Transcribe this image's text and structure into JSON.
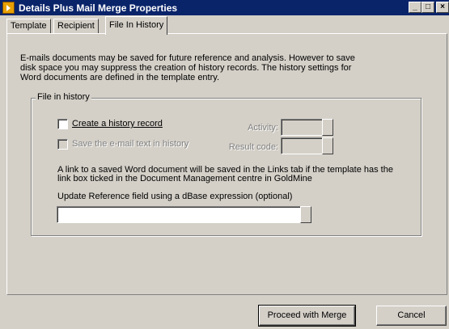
{
  "window": {
    "title": "Details Plus Mail Merge Properties",
    "controls": {
      "minimize": "_",
      "maximize": "□",
      "close": "×"
    }
  },
  "tabs": [
    {
      "label": "Template",
      "active": false
    },
    {
      "label": "Recipient",
      "active": false
    },
    {
      "label": "File In History",
      "active": true
    }
  ],
  "intro_lines": [
    "E-mails documents may be saved for future reference and analysis. However to save",
    "disk space you may suppress the creation of history records. The history settings for",
    "Word documents are defined in the template entry."
  ],
  "group": {
    "title": "File in history",
    "create_history_label": "Create a history record",
    "create_history_checked": false,
    "save_email_text_label": "Save the e-mail text in history",
    "save_email_text_checked": false,
    "activity_label": "Activity:",
    "activity_value": "",
    "result_code_label": "Result code:",
    "result_code_value": "",
    "link_note_lines": [
      "A link to a saved Word document will be saved in the Links tab if the template has the",
      "link box ticked in the Document Management centre in GoldMine"
    ],
    "reference_label": "Update Reference field using a dBase expression (optional)",
    "reference_value": ""
  },
  "buttons": {
    "proceed": "Proceed with Merge",
    "cancel": "Cancel"
  },
  "colors": {
    "face": "#d4d0c8",
    "titlebar": "#0a246a",
    "disabled_text": "#808080"
  }
}
